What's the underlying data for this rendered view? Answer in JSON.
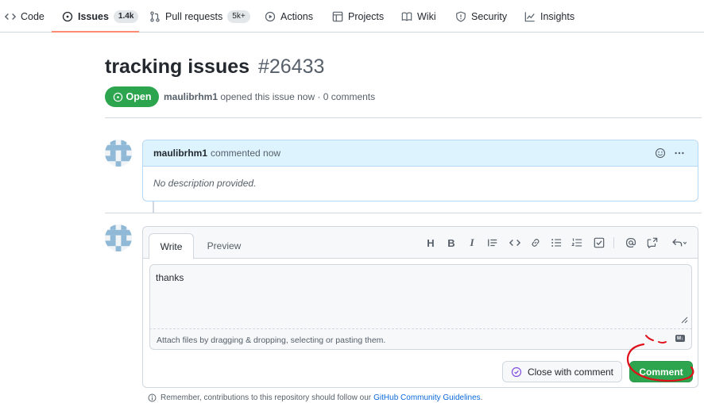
{
  "nav": {
    "items": [
      {
        "label": "Code",
        "icon": "code-icon"
      },
      {
        "label": "Issues",
        "icon": "issue-opened-icon",
        "counter": "1.4k"
      },
      {
        "label": "Pull requests",
        "icon": "git-pull-request-icon",
        "counter": "5k+"
      },
      {
        "label": "Actions",
        "icon": "play-icon"
      },
      {
        "label": "Projects",
        "icon": "table-icon"
      },
      {
        "label": "Wiki",
        "icon": "book-icon"
      },
      {
        "label": "Security",
        "icon": "shield-icon"
      },
      {
        "label": "Insights",
        "icon": "graph-icon"
      }
    ],
    "selected": "Issues"
  },
  "issue": {
    "title": "tracking issues",
    "number": "#26433",
    "state": "Open",
    "author": "maulibrhm1",
    "meta_suffix": "opened this issue now · 0 comments"
  },
  "comment": {
    "author": "maulibrhm1",
    "action": "commented now",
    "body": "No description provided."
  },
  "editor": {
    "tabs": [
      "Write",
      "Preview"
    ],
    "text": "thanks",
    "attach_hint": "Attach files by dragging & dropping, selecting or pasting them.",
    "markdown_badge": "M↓",
    "toolbar": [
      "heading-icon",
      "bold-icon",
      "italic-icon",
      "quote-icon",
      "code-icon",
      "link-icon",
      "unordered-list-icon",
      "ordered-list-icon",
      "task-list-icon",
      "mention-icon",
      "cross-reference-icon",
      "reply-icon"
    ]
  },
  "buttons": {
    "close_label": "Close with comment",
    "comment_label": "Comment"
  },
  "footer": {
    "text": "Remember, contributions to this repository should follow our",
    "link": "GitHub Community Guidelines",
    "suffix": "."
  },
  "colors": {
    "accent_green": "#2da44e",
    "nav_underline": "#fd8c73",
    "link_blue": "#0969da",
    "comment_header": "#ddf4ff",
    "annotation_red": "#e0101a"
  }
}
